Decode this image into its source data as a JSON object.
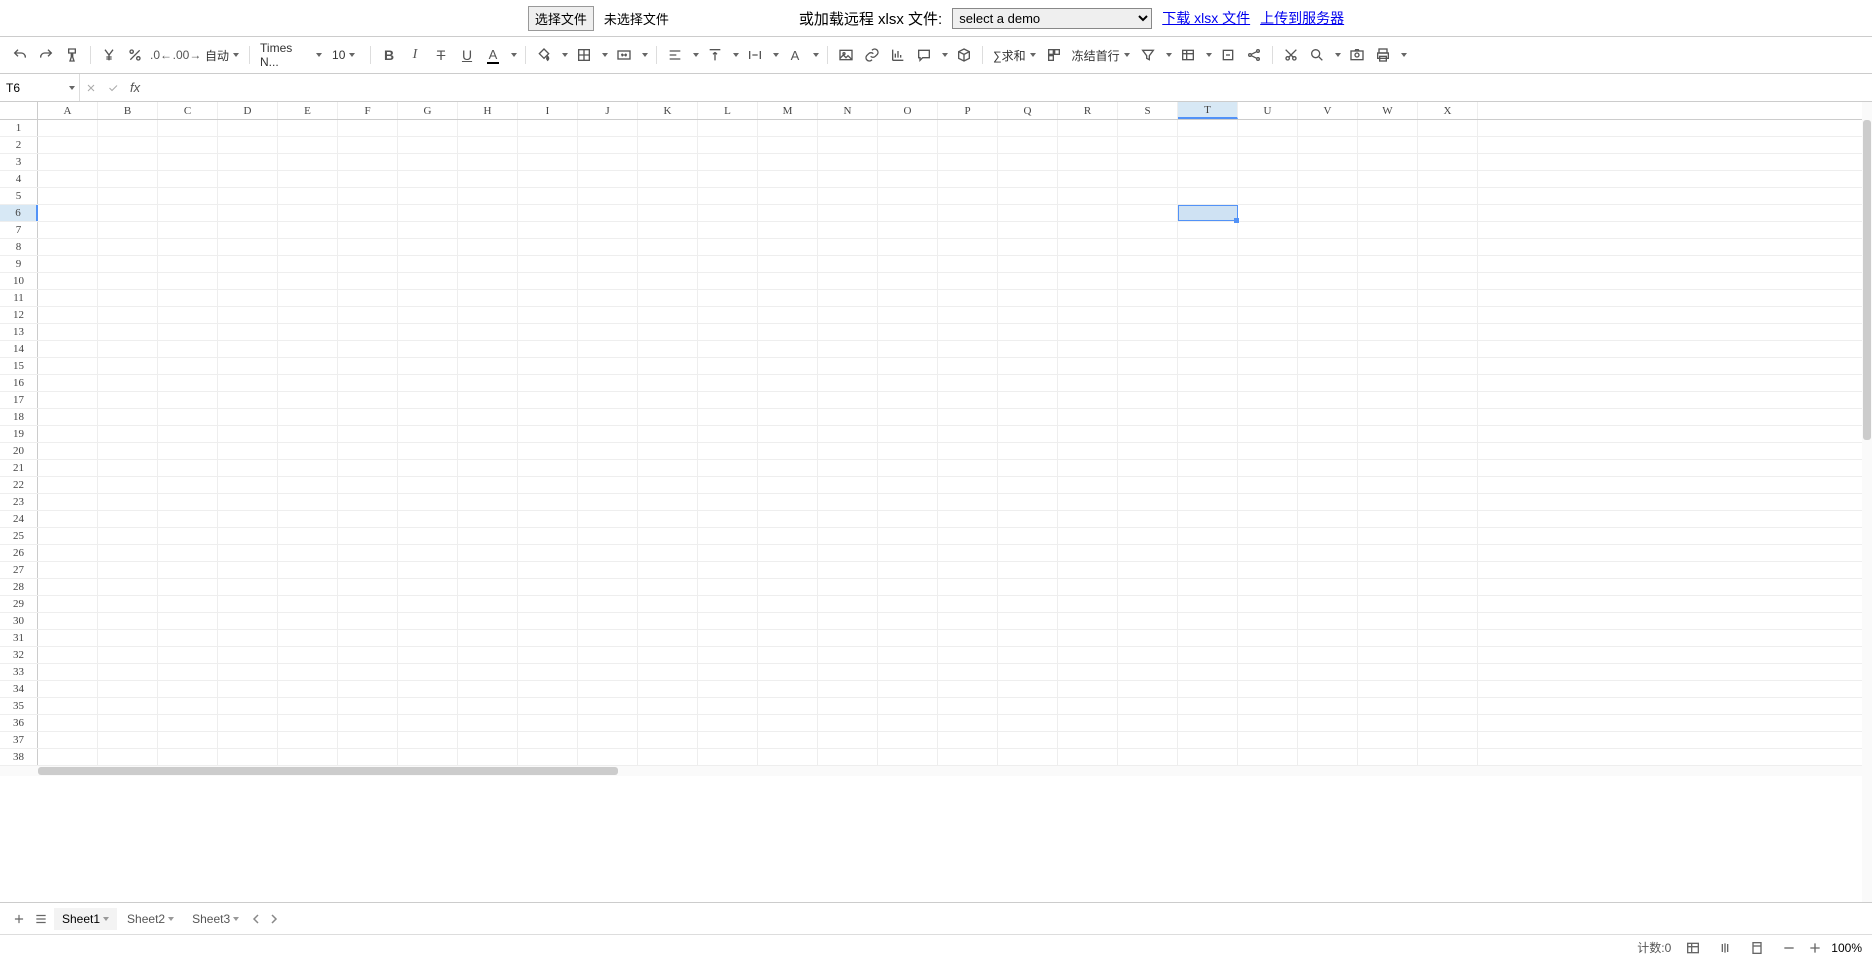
{
  "topbar": {
    "choose_file_label": "选择文件",
    "no_file_label": "未选择文件",
    "remote_label": "或加载远程 xlsx 文件:",
    "demo_placeholder": "select a demo",
    "download_link": "下载 xlsx 文件",
    "upload_link": "上传到服务器"
  },
  "toolbar": {
    "number_format": "自动",
    "font_name": "Times N...",
    "font_size": "10",
    "sum_label": "∑求和",
    "freeze_label": "冻结首行"
  },
  "formula_bar": {
    "name_box": "T6",
    "fx": "fx",
    "value": ""
  },
  "columns": [
    "A",
    "B",
    "C",
    "D",
    "E",
    "F",
    "G",
    "H",
    "I",
    "J",
    "K",
    "L",
    "M",
    "N",
    "O",
    "P",
    "Q",
    "R",
    "S",
    "T",
    "U",
    "V",
    "W",
    "X"
  ],
  "rows": [
    1,
    2,
    3,
    4,
    5,
    6,
    7,
    8,
    9,
    10,
    11,
    12,
    13,
    14,
    15,
    16,
    17,
    18,
    19,
    20,
    21,
    22,
    23,
    24,
    25,
    26,
    27,
    28,
    29,
    30,
    31,
    32,
    33,
    34,
    35,
    36,
    37,
    38
  ],
  "selected": {
    "col": "T",
    "row": 6
  },
  "sheets": [
    {
      "name": "Sheet1",
      "active": true
    },
    {
      "name": "Sheet2",
      "active": false
    },
    {
      "name": "Sheet3",
      "active": false
    }
  ],
  "status": {
    "count_label": "计数:0",
    "zoom": "100%"
  }
}
